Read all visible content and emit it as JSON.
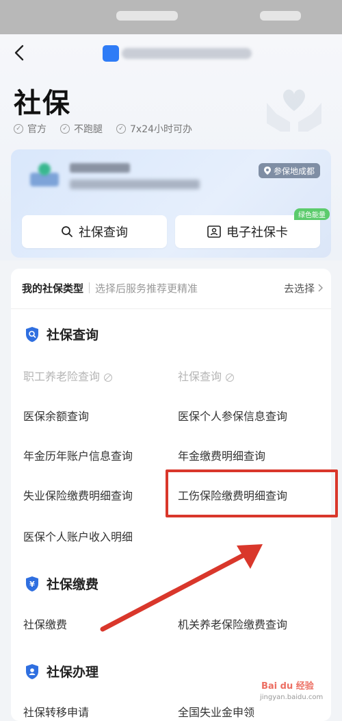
{
  "page": {
    "title": "社保"
  },
  "features": [
    "官方",
    "不跑腿",
    "7x24小时可办"
  ],
  "card": {
    "location": "参保地成都",
    "buttons": {
      "query": "社保查询",
      "card": "电子社保卡"
    },
    "badge": "绿色能量"
  },
  "type_row": {
    "label": "我的社保类型",
    "hint": "选择后服务推荐更精准",
    "action": "去选择"
  },
  "sections": [
    {
      "title": "社保查询",
      "items": [
        {
          "label": "职工养老险查询",
          "disabled": true
        },
        {
          "label": "社保查询",
          "disabled": true
        },
        {
          "label": "医保余额查询"
        },
        {
          "label": "医保个人参保信息查询"
        },
        {
          "label": "年金历年账户信息查询"
        },
        {
          "label": "年金缴费明细查询"
        },
        {
          "label": "失业保险缴费明细查询"
        },
        {
          "label": "工伤保险缴费明细查询",
          "highlighted": true
        },
        {
          "label": "医保个人账户收入明细"
        }
      ]
    },
    {
      "title": "社保缴费",
      "items": [
        {
          "label": "社保缴费"
        },
        {
          "label": "机关养老保险缴费查询"
        }
      ]
    },
    {
      "title": "社保办理",
      "items": [
        {
          "label": "社保转移申请"
        },
        {
          "label": "全国失业金申领"
        }
      ]
    }
  ],
  "watermark": {
    "brand": "Bai du 经验",
    "site": "jingyan.baidu.com"
  },
  "colors": {
    "accent": "#2f6fe0",
    "highlight": "#d9372b"
  }
}
